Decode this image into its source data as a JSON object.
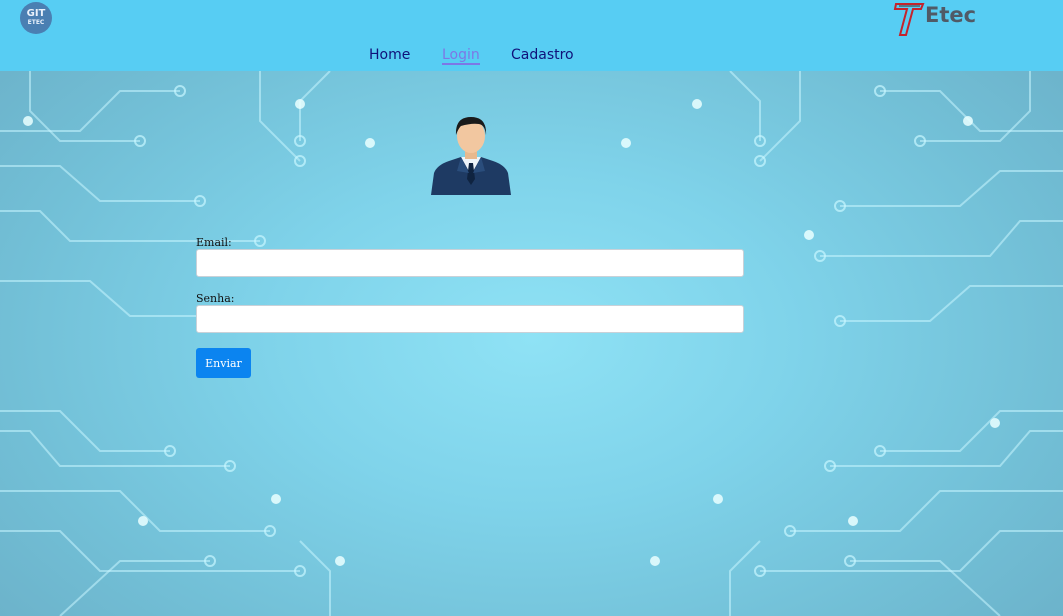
{
  "header": {
    "left_logo": {
      "line1": "GIT",
      "line2": "ETEC"
    },
    "right_logo": {
      "word": "Etec"
    }
  },
  "nav": {
    "items": [
      "Home",
      "Login",
      "Cadastro"
    ],
    "active": "Login"
  },
  "form": {
    "email_label": "Email:",
    "email_value": "",
    "password_label": "Senha:",
    "password_value": "",
    "submit_label": "Enviar"
  },
  "colors": {
    "header_bg": "#57cdf3",
    "nav_link": "#10127a",
    "nav_active": "#7d77e6",
    "button_bg": "#0b84f0",
    "circuit": "#c8f6ff"
  },
  "icons": [
    "git-etec-logo",
    "etec-logo",
    "user-avatar-icon",
    "circuit-background"
  ]
}
